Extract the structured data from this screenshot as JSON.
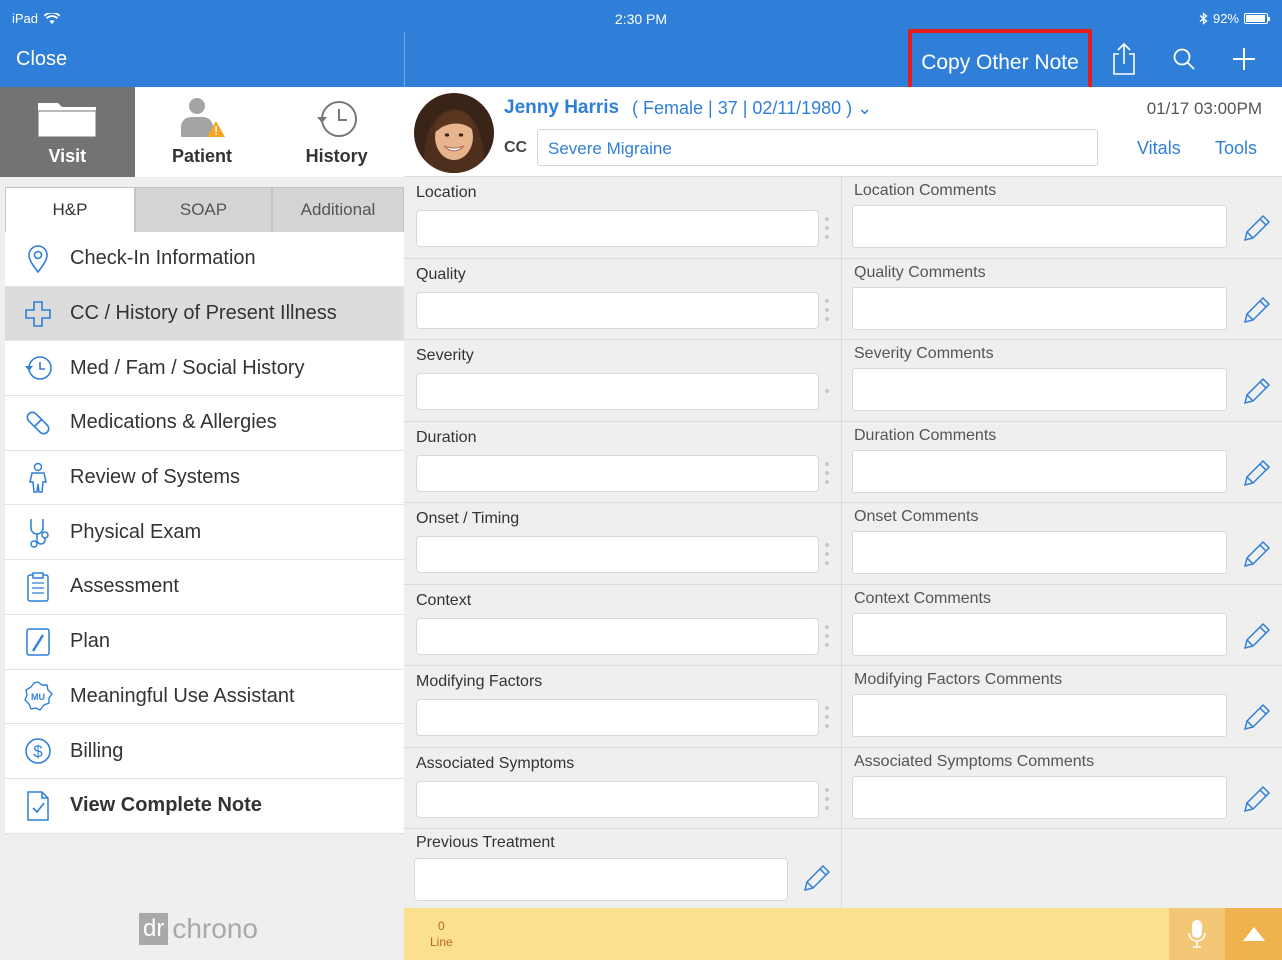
{
  "status": {
    "device": "iPad",
    "time": "2:30 PM",
    "battery": "92%"
  },
  "nav": {
    "close_label": "Close",
    "copy_note_label": "Copy Other Note",
    "highlight_color": "#e41c1c",
    "accent": "#2f7fd8"
  },
  "modes": [
    {
      "label": "Visit",
      "icon": "folder-icon",
      "active": true
    },
    {
      "label": "Patient",
      "icon": "patient-warning-icon",
      "active": false
    },
    {
      "label": "History",
      "icon": "history-clock-icon",
      "active": false
    }
  ],
  "subtabs": [
    "H&P",
    "SOAP",
    "Additional"
  ],
  "menu": [
    {
      "label": "Check-In Information",
      "icon": "location-pin-icon"
    },
    {
      "label": "CC / History of Present Illness",
      "icon": "medical-cross-icon"
    },
    {
      "label": "Med / Fam / Social History",
      "icon": "history-clock-icon"
    },
    {
      "label": "Medications & Allergies",
      "icon": "pill-icon"
    },
    {
      "label": "Review of Systems",
      "icon": "body-icon"
    },
    {
      "label": "Physical Exam",
      "icon": "stethoscope-icon"
    },
    {
      "label": "Assessment",
      "icon": "clipboard-icon"
    },
    {
      "label": "Plan",
      "icon": "pen-icon"
    },
    {
      "label": "Meaningful Use Assistant",
      "icon": "mu-badge-icon"
    },
    {
      "label": "Billing",
      "icon": "dollar-icon"
    },
    {
      "label": "View Complete Note",
      "icon": "note-check-icon"
    }
  ],
  "logo": {
    "dr": "dr",
    "chrono": "chrono"
  },
  "patient": {
    "name": "Jenny Harris",
    "demographics": "( Female | 37 | 02/11/1980 ) ⌄",
    "visit_time": "01/17 03:00PM",
    "cc_label": "CC",
    "cc_value": "Severe Migraine",
    "vitals_label": "Vitals",
    "tools_label": "Tools"
  },
  "form": {
    "rows": [
      {
        "left": "Location",
        "right": "Location Comments"
      },
      {
        "left": "Quality",
        "right": "Quality Comments"
      },
      {
        "left": "Severity",
        "right": "Severity Comments"
      },
      {
        "left": "Duration",
        "right": "Duration Comments"
      },
      {
        "left": "Onset / Timing",
        "right": "Onset Comments"
      },
      {
        "left": "Context",
        "right": "Context Comments"
      },
      {
        "left": "Modifying Factors",
        "right": "Modifying Factors Comments"
      },
      {
        "left": "Associated Symptoms",
        "right": "Associated Symptoms Comments"
      }
    ],
    "previous_treatment": "Previous Treatment"
  },
  "bottom": {
    "line_count": "0",
    "line_label": "Line"
  }
}
